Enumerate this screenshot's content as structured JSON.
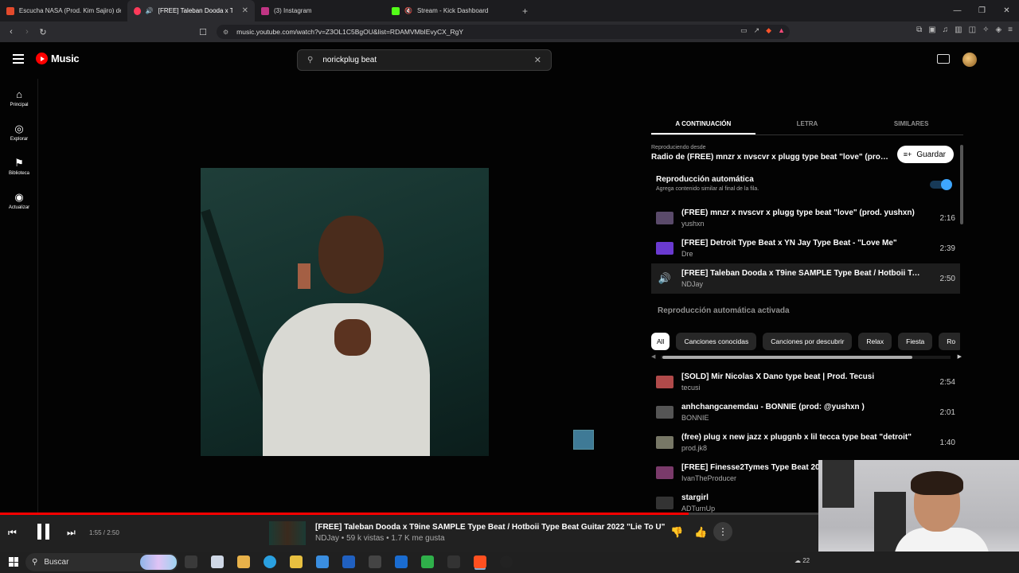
{
  "browser": {
    "tabs": [
      {
        "label": "Escucha NASA (Prod. Kim Sajiro) de",
        "color": "#e34a2c",
        "active": false
      },
      {
        "label": "[FREE] Taleban Dooda x T9ine",
        "color": "#ff3a5a",
        "active": true
      },
      {
        "label": "(3) Instagram",
        "color": "#c13584",
        "active": false
      },
      {
        "label": "Stream - Kick Dashboard",
        "color": "#53fc18",
        "active": false
      }
    ],
    "url": "music.youtube.com/watch?v=Z3OL1C5BgOU&list=RDAMVMbIEvyCX_RgY"
  },
  "header": {
    "logo_text": "Music",
    "search_value": "norickplug beat"
  },
  "sidebar": {
    "items": [
      {
        "label": "Principal",
        "icon": "home-icon"
      },
      {
        "label": "Explorar",
        "icon": "compass-icon"
      },
      {
        "label": "Biblioteca",
        "icon": "library-icon"
      },
      {
        "label": "Actualizar",
        "icon": "upgrade-icon"
      }
    ]
  },
  "panel": {
    "tabs": [
      "A CONTINUACIÓN",
      "LETRA",
      "SIMILARES"
    ],
    "playing_from_label": "Reproduciendo desde",
    "playing_from_title": "Radio de (FREE) mnzr x nvscvr x plugg type beat \"love\" (prod. y...",
    "save_label": "Guardar",
    "autoplay_title": "Reproducción automática",
    "autoplay_sub": "Agrega contenido similar al final de la fila.",
    "queue": [
      {
        "title": "(FREE) mnzr x nvscvr x plugg type beat \"love\" (prod. yushxn)",
        "artist": "yushxn",
        "duration": "2:16",
        "thumb": "#5a4a6a"
      },
      {
        "title": "[FREE] Detroit Type Beat x YN Jay Type Beat - \"Love Me\"",
        "artist": "Dre",
        "duration": "2:39",
        "thumb": "#6a3ad0"
      },
      {
        "title": "[FREE] Taleban Dooda x T9ine SAMPLE Type Beat / Hotboii Typ...",
        "artist": "NDJay",
        "duration": "2:50",
        "thumb": "#1d1d1d"
      }
    ],
    "autoplay_note": "Reproducción automática activada",
    "chips": [
      "All",
      "Canciones conocidas",
      "Canciones por descubrir",
      "Relax",
      "Fiesta",
      "Ro"
    ],
    "autoplay_list": [
      {
        "title": "[SOLD] Mir Nicolas X Dano type beat | Prod. Tecusi",
        "artist": "tecusi",
        "duration": "2:54",
        "thumb": "#b04a4a"
      },
      {
        "title": "anhchangcanemdau - BONNIE (prod: @yushxn )",
        "artist": "BONNIE",
        "duration": "2:01",
        "thumb": "#555555"
      },
      {
        "title": "(free) plug x new jazz x pluggnb x lil tecca type beat \"detroit\"",
        "artist": "prod.jk8",
        "duration": "1:40",
        "thumb": "#777766"
      },
      {
        "title": "[FREE] Finesse2Tymes Type Beat 20",
        "artist": "IvanTheProducer",
        "duration": "",
        "thumb": "#7a3a6a"
      },
      {
        "title": "stargirl",
        "artist": "ADTurnUp",
        "duration": "",
        "thumb": "#333333"
      }
    ]
  },
  "player": {
    "time": "1:55 / 2:50",
    "progress": 0.676,
    "title": "[FREE] Taleban Dooda x T9ine SAMPLE Type Beat / Hotboii Type Beat Guitar 2022 \"Lie To U\"",
    "meta": "NDJay • 59 k vistas • 1.7 K me gusta"
  },
  "taskbar": {
    "search_label": "Buscar",
    "apps": [
      "#3a3a3a",
      "#cfd8e6",
      "#e8b24a",
      "#2aa0e0",
      "#e8c040",
      "#3a8ee0",
      "#2060c0",
      "#444444",
      "#1a6cd0",
      "#2fb04a",
      "#333333",
      "#ff5020",
      "#222222"
    ],
    "tray_text": "22"
  }
}
